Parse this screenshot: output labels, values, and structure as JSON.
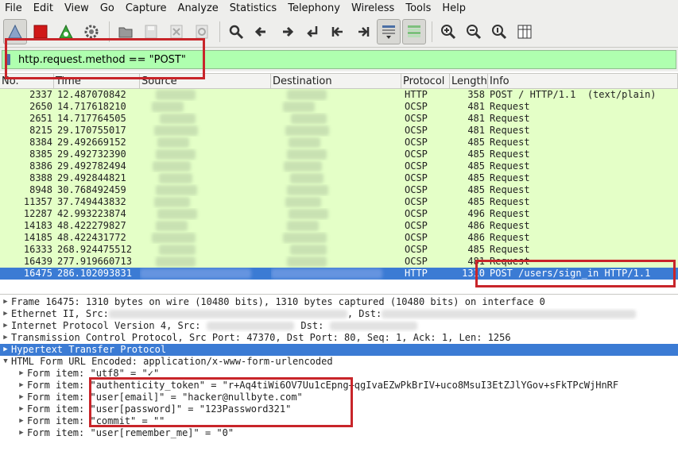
{
  "menu": [
    "File",
    "Edit",
    "View",
    "Go",
    "Capture",
    "Analyze",
    "Statistics",
    "Telephony",
    "Wireless",
    "Tools",
    "Help"
  ],
  "filter": {
    "value": "http.request.method == \"POST\""
  },
  "columns": [
    "No.",
    "Time",
    "Source",
    "Destination",
    "Protocol",
    "Length",
    "Info"
  ],
  "packets": [
    {
      "no": "2337",
      "time": "12.487070842",
      "proto": "HTTP",
      "len": "358",
      "info": "POST / HTTP/1.1  (text/plain)"
    },
    {
      "no": "2650",
      "time": "14.717618210",
      "proto": "OCSP",
      "len": "481",
      "info": "Request"
    },
    {
      "no": "2651",
      "time": "14.717764505",
      "proto": "OCSP",
      "len": "481",
      "info": "Request"
    },
    {
      "no": "8215",
      "time": "29.170755017",
      "proto": "OCSP",
      "len": "481",
      "info": "Request"
    },
    {
      "no": "8384",
      "time": "29.492669152",
      "proto": "OCSP",
      "len": "485",
      "info": "Request"
    },
    {
      "no": "8385",
      "time": "29.492732390",
      "proto": "OCSP",
      "len": "485",
      "info": "Request"
    },
    {
      "no": "8386",
      "time": "29.492782494",
      "proto": "OCSP",
      "len": "485",
      "info": "Request"
    },
    {
      "no": "8388",
      "time": "29.492844821",
      "proto": "OCSP",
      "len": "485",
      "info": "Request"
    },
    {
      "no": "8948",
      "time": "30.768492459",
      "proto": "OCSP",
      "len": "485",
      "info": "Request"
    },
    {
      "no": "11357",
      "time": "37.749443832",
      "proto": "OCSP",
      "len": "485",
      "info": "Request"
    },
    {
      "no": "12287",
      "time": "42.993223874",
      "proto": "OCSP",
      "len": "496",
      "info": "Request"
    },
    {
      "no": "14183",
      "time": "48.422279827",
      "proto": "OCSP",
      "len": "486",
      "info": "Request"
    },
    {
      "no": "14185",
      "time": "48.422431772",
      "proto": "OCSP",
      "len": "486",
      "info": "Request"
    },
    {
      "no": "16333",
      "time": "268.924475512",
      "proto": "OCSP",
      "len": "485",
      "info": "Request"
    },
    {
      "no": "16439",
      "time": "277.919660713",
      "proto": "OCSP",
      "len": "481",
      "info": "Request"
    },
    {
      "no": "16475",
      "time": "286.102093831",
      "proto": "HTTP",
      "len": "1310",
      "info": "POST /users/sign_in HTTP/1.1",
      "selected": true
    }
  ],
  "details": {
    "frame": "Frame 16475: 1310 bytes on wire (10480 bits), 1310 bytes captured (10480 bits) on interface 0",
    "ethernet_a": "Ethernet II, Src:",
    "ethernet_b": ", Dst:",
    "ip_a": "Internet Protocol Version 4, Src:",
    "ip_b": "Dst:",
    "tcp": "Transmission Control Protocol, Src Port: 47370, Dst Port: 80, Seq: 1, Ack: 1, Len: 1256",
    "http": "Hypertext Transfer Protocol",
    "form": "HTML Form URL Encoded: application/x-www-form-urlencoded",
    "items": [
      "Form item: \"utf8\" = \"✓\"",
      "Form item: \"authenticity_token\" = \"r+Aq4tiWi6OV7Uu1cEpng+qgIvaEZwPkBrIV+uco8MsuI3EtZJlYGov+sFkTPcWjHnRF",
      "Form item: \"user[email]\" = \"hacker@nullbyte.com\"",
      "Form item: \"user[password]\" = \"123Password321\"",
      "Form item: \"commit\" = \"\"",
      "Form item: \"user[remember_me]\" = \"0\""
    ]
  },
  "colors": {
    "filter_bg": "#afffaf",
    "row_bg": "#e4ffc7",
    "selection": "#3b7bd4",
    "annotation": "#c8252a"
  }
}
